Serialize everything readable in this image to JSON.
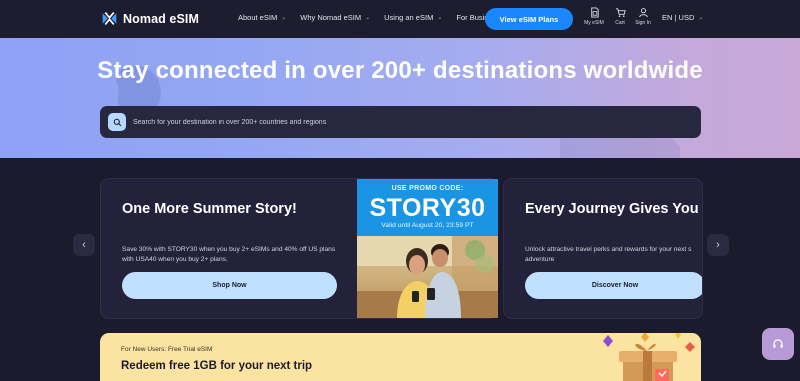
{
  "header": {
    "brand": "Nomad eSIM",
    "nav_links": [
      {
        "label": "About eSIM",
        "has_dropdown": true
      },
      {
        "label": "Why Nomad eSIM",
        "has_dropdown": true
      },
      {
        "label": "Using an eSIM",
        "has_dropdown": true
      },
      {
        "label": "For Business",
        "has_dropdown": false
      }
    ],
    "cta_label": "View eSIM Plans",
    "icons": [
      {
        "icon": "sim-card-icon",
        "label": "My eSIM"
      },
      {
        "icon": "cart-icon",
        "label": "Cart"
      },
      {
        "icon": "user-icon",
        "label": "Sign In"
      }
    ],
    "language_currency": "EN | USD"
  },
  "hero": {
    "title": "Stay connected in over 200+ destinations worldwide",
    "search_placeholder": "Search for your destination in over 200+ countries and regions"
  },
  "carousel": {
    "prev_symbol": "‹",
    "next_symbol": "›",
    "cards": [
      {
        "title": "One More Summer Story!",
        "description": "Save 30% with STORY30 when you buy 2+ eSIMs and 40% off US plans with USA40 when you buy 2+ plans.",
        "button_label": "Shop Now",
        "promo": {
          "label": "USE PROMO CODE:",
          "code": "STORY30",
          "validity": "Valid until August 20, 23:59 PT"
        }
      },
      {
        "title": "Every Journey Gives You Mo",
        "description": "Unlock attractive travel perks and rewards for your next s adventure",
        "button_label": "Discover Now"
      }
    ]
  },
  "banner": {
    "subtitle": "For New Users: Free Trial eSIM",
    "title": "Redeem free 1GB for your next trip"
  },
  "colors": {
    "background": "#1c1b2e",
    "primary_button": "#1b87ff",
    "card_button": "#bfe1ff",
    "banner": "#fbe3a1",
    "support_button": "#b79bd8"
  }
}
